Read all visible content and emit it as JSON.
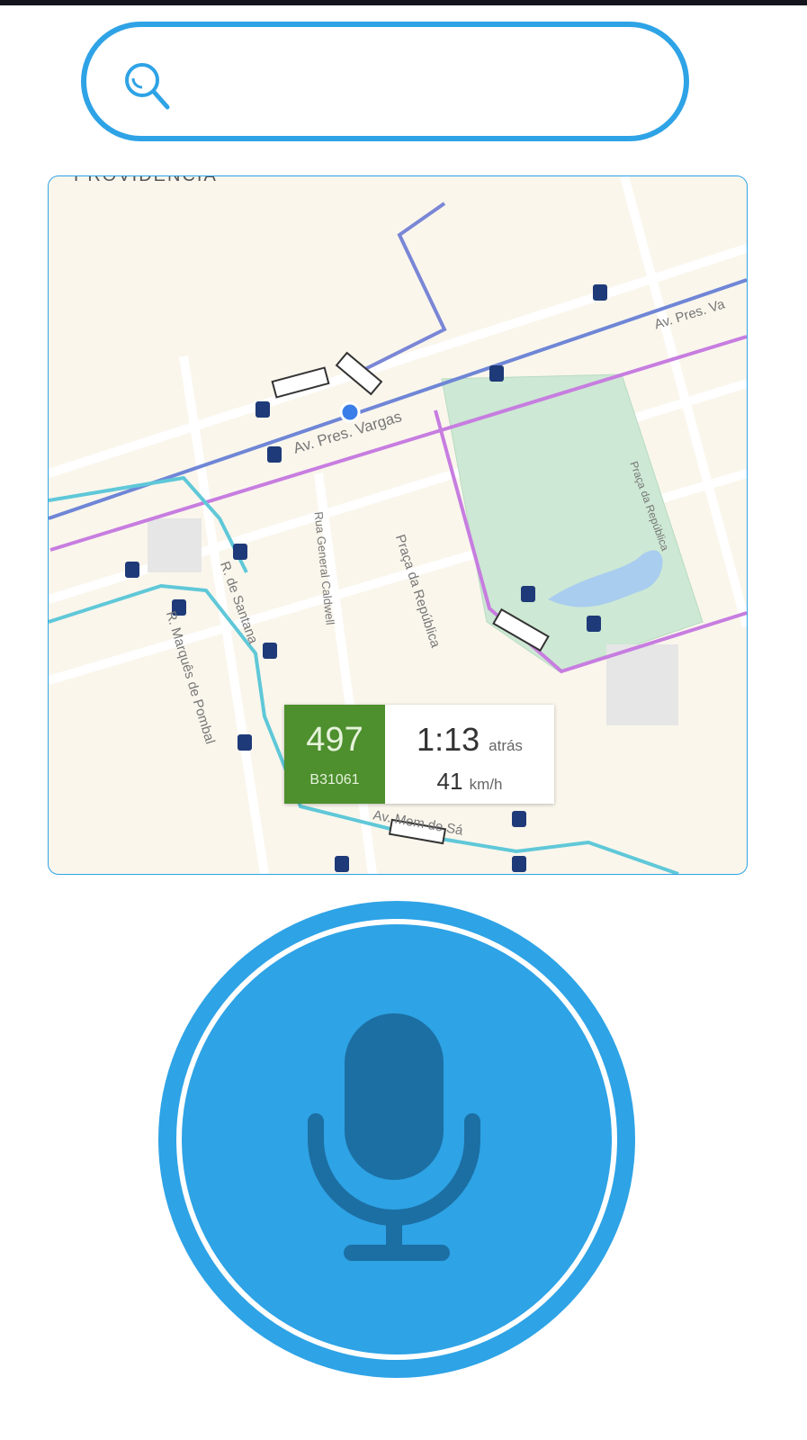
{
  "search": {
    "placeholder": "",
    "value": ""
  },
  "map": {
    "labels": {
      "district": "PROVIDÊNCIA",
      "avenue1": "Av. Pres. Vargas",
      "avenue2": "Av. Pres. Va",
      "square": "Praça da República",
      "square2": "Praça da República",
      "street1": "Rua General Caldwell",
      "street2": "R. de Santana",
      "street3": "R. Marquês de Pombal",
      "street4": "Av. Mem de Sá"
    },
    "bus_card": {
      "route": "497",
      "vehicle": "B31061",
      "time": "1:13",
      "time_suffix": "atrás",
      "speed": "41",
      "speed_unit": "km/h"
    }
  },
  "colors": {
    "accent": "#2ea3e6",
    "route_green": "#4e8f2e",
    "mic_dark": "#1c6fa3"
  }
}
